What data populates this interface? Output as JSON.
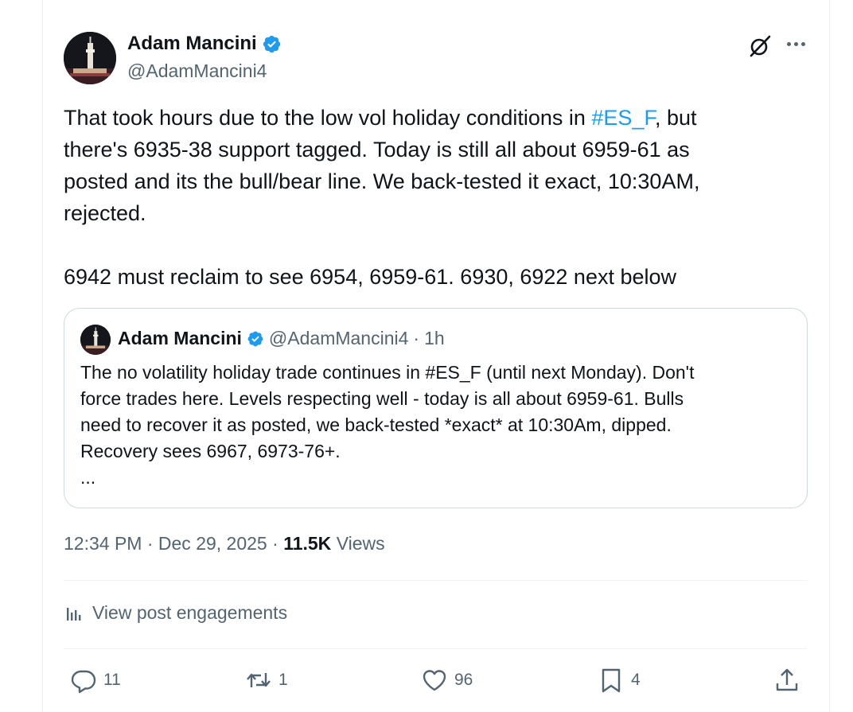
{
  "author": {
    "name": "Adam Mancini",
    "handle": "@AdamMancini4"
  },
  "tweet": {
    "line1_a": "That took hours due to the low vol holiday conditions in ",
    "hashtag": "#ES_F",
    "line1_b": ", but",
    "line2": "there's 6935-38 support tagged. Today is still all about 6959-61 as",
    "line3": "posted and its the bull/bear line. We back-tested it exact, 10:30AM,",
    "line4": "rejected.",
    "line5": "6942 must reclaim to see 6954, 6959-61. 6930, 6922 next below"
  },
  "quote": {
    "name": "Adam Mancini",
    "handle": "@AdamMancini4",
    "separator": "·",
    "time": "1h",
    "lines": [
      "The no volatility holiday trade continues in #ES_F (until next Monday). Don't",
      "force trades here. Levels respecting well - today is all about 6959-61. Bulls",
      "need to recover it as posted, we back-tested *exact* at 10:30Am, dipped.",
      "Recovery sees 6967, 6973-76+.",
      "..."
    ]
  },
  "meta": {
    "time": "12:34 PM",
    "sep1": "·",
    "date": "Dec 29, 2025",
    "sep2": "·",
    "views_count": "11.5K",
    "views_label": "Views"
  },
  "engagements_label": "View post engagements",
  "actions": {
    "replies": "11",
    "reposts": "1",
    "likes": "96",
    "bookmarks": "4"
  },
  "colors": {
    "accent": "#1d9bf0",
    "text": "#0f1419",
    "secondary": "#536471",
    "border": "#cfd9de"
  }
}
